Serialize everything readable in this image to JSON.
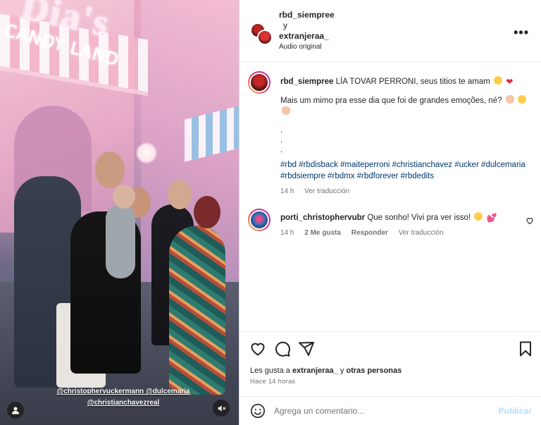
{
  "media": {
    "sign_big": "Dia's",
    "sign_small": "CANDY LAND",
    "mention_line1": "@christophervuckermann @dulcemaria",
    "mention_line2": "@christianchavezreal",
    "user_icon": "user-icon",
    "mute_icon": "speaker-muted-icon"
  },
  "header": {
    "author": "rbd_siempree",
    "connector": "y",
    "collaborator": "extranjeraa_",
    "audio": "Audio original",
    "more_icon": "more-horizontal-icon",
    "more_label": "•••"
  },
  "caption": {
    "username": "rbd_siempree",
    "line1": "LÍA TOVAR PERRONI, seus titios te amam",
    "line2": "Mais um mimo pra esse dia que foi de grandes emoções, né?",
    "dots": [
      ".",
      ".",
      "."
    ],
    "hashtags": "#rbd #rbdisback #maiteperroni #christianchavez #ucker #dulcemaria #rbdsiempre #rbdmx #rbdforever #rbdedits",
    "time": "14 h",
    "translate": "Ver traducción",
    "heart_glyph": "❤"
  },
  "reply": {
    "username": "porti_christophervubr",
    "text": "Que sonho! Vivi pra ver isso!",
    "time": "14 h",
    "likes": "2 Me gusta",
    "respond": "Responder",
    "translate": "Ver traducción",
    "heart_glyph": "💕"
  },
  "actions": {
    "like_icon": "heart-icon",
    "comment_icon": "comment-icon",
    "share_icon": "share-icon",
    "save_icon": "bookmark-icon",
    "likes_prefix": "Les gusta a",
    "likes_user": "extranjeraa_",
    "likes_connector": "y",
    "likes_others": "otras personas",
    "timestamp": "Hace 14 horas"
  },
  "composer": {
    "placeholder": "Agrega un comentario...",
    "publish": "Publicar",
    "emoji_icon": "emoji-icon"
  },
  "colors": {
    "link": "#00376b",
    "muted": "#737373",
    "publish_disabled": "#b2dffc",
    "text": "#262626"
  }
}
